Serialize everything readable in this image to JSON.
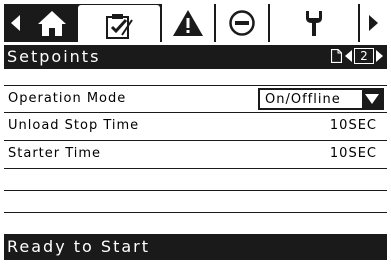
{
  "tabs": {
    "prev_icon": "chevron-left-icon",
    "home_icon": "home-icon",
    "setpoints_icon": "clipboard-check-icon",
    "alarm_icon": "warning-triangle-icon",
    "stop_icon": "stop-circle-icon",
    "service_icon": "wrench-icon",
    "next_icon": "chevron-right-icon",
    "active": "setpoints"
  },
  "header": {
    "title": "Setpoints",
    "page_number": "2",
    "page_icon": "document-icon"
  },
  "rows": [
    {
      "label": "Operation Mode",
      "value": "On/Offline",
      "type": "dropdown"
    },
    {
      "label": "Unload Stop Time",
      "value": "10SEC",
      "type": "value"
    },
    {
      "label": "Starter Time",
      "value": "10SEC",
      "type": "value"
    }
  ],
  "status": {
    "text": "Ready to Start"
  },
  "colors": {
    "dark": "#1a1a1a",
    "light": "#ffffff"
  }
}
